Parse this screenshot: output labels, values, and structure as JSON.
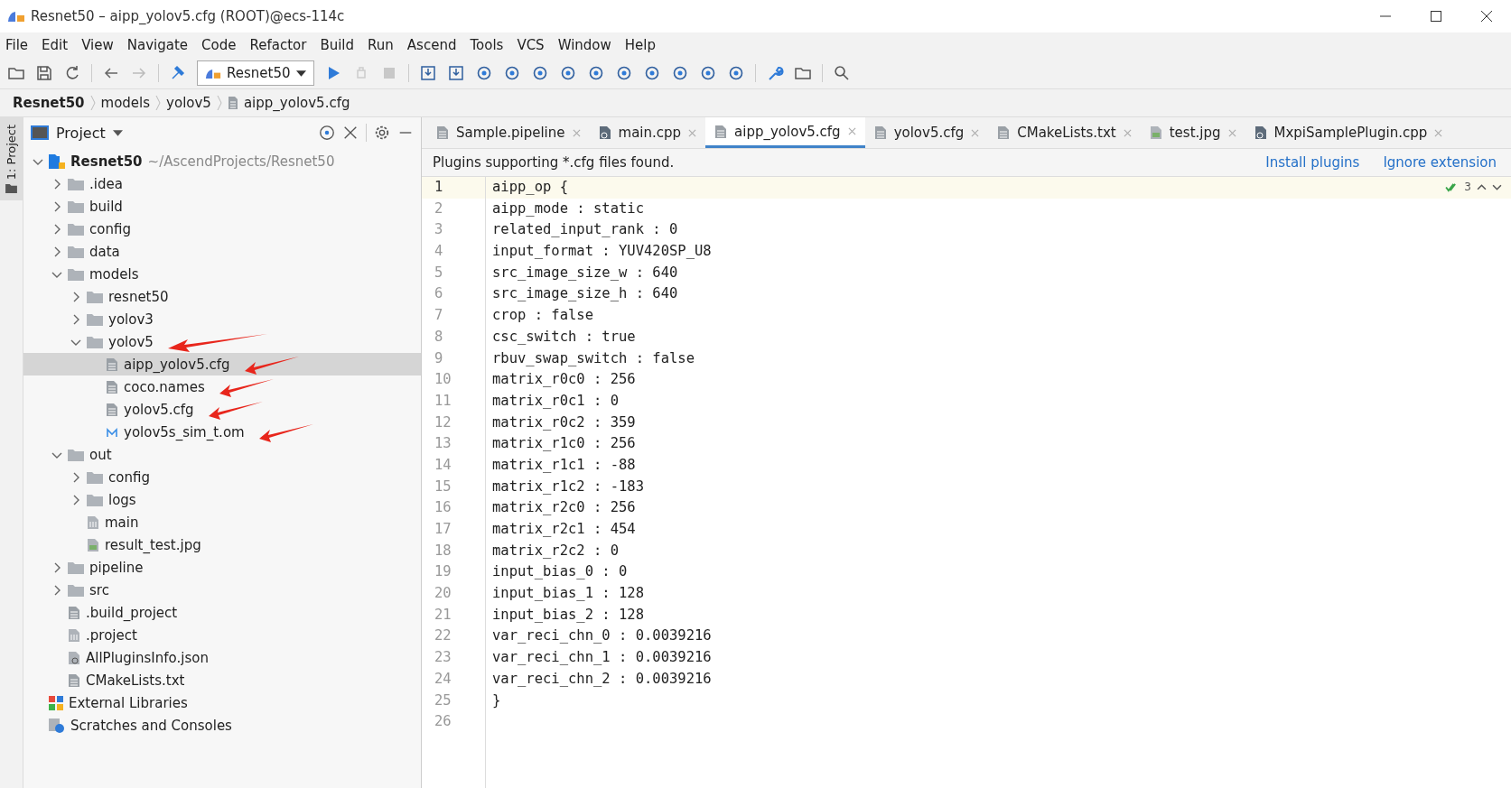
{
  "window": {
    "title": "Resnet50 – aipp_yolov5.cfg (ROOT)@ecs-114c"
  },
  "menu": [
    "File",
    "Edit",
    "View",
    "Navigate",
    "Code",
    "Refactor",
    "Build",
    "Run",
    "Ascend",
    "Tools",
    "VCS",
    "Window",
    "Help"
  ],
  "toolbar": {
    "run_config": "Resnet50"
  },
  "breadcrumb": [
    "Resnet50",
    "models",
    "yolov5",
    "aipp_yolov5.cfg"
  ],
  "side_strip": {
    "label": "1: Project"
  },
  "project": {
    "title": "Project",
    "tree": [
      {
        "name": "Resnet50",
        "path": "~/AscendProjects/Resnet50",
        "kind": "project",
        "expanded": true,
        "selected": false,
        "arrow": false,
        "children": [
          {
            "name": ".idea",
            "kind": "folder",
            "expanded": false,
            "selected": false,
            "arrow": false
          },
          {
            "name": "build",
            "kind": "folder",
            "expanded": false,
            "selected": false,
            "arrow": false
          },
          {
            "name": "config",
            "kind": "folder",
            "expanded": false,
            "selected": false,
            "arrow": false
          },
          {
            "name": "data",
            "kind": "folder",
            "expanded": false,
            "selected": false,
            "arrow": false
          },
          {
            "name": "models",
            "kind": "folder",
            "expanded": true,
            "selected": false,
            "arrow": false,
            "children": [
              {
                "name": "resnet50",
                "kind": "folder",
                "expanded": false,
                "selected": false,
                "arrow": false
              },
              {
                "name": "yolov3",
                "kind": "folder",
                "expanded": false,
                "selected": false,
                "arrow": false
              },
              {
                "name": "yolov5",
                "kind": "folder",
                "expanded": true,
                "selected": false,
                "arrow": true,
                "children": [
                  {
                    "name": "aipp_yolov5.cfg",
                    "kind": "file",
                    "selected": true,
                    "arrow": true
                  },
                  {
                    "name": "coco.names",
                    "kind": "file",
                    "selected": false,
                    "arrow": true
                  },
                  {
                    "name": "yolov5.cfg",
                    "kind": "file",
                    "selected": false,
                    "arrow": true
                  },
                  {
                    "name": "yolov5s_sim_t.om",
                    "kind": "model",
                    "selected": false,
                    "arrow": true
                  }
                ]
              }
            ]
          },
          {
            "name": "out",
            "kind": "folder",
            "expanded": true,
            "selected": false,
            "arrow": false,
            "children": [
              {
                "name": "config",
                "kind": "folder",
                "expanded": false,
                "selected": false,
                "arrow": false
              },
              {
                "name": "logs",
                "kind": "folder",
                "expanded": false,
                "selected": false,
                "arrow": false
              },
              {
                "name": "main",
                "kind": "binary",
                "selected": false,
                "arrow": false
              },
              {
                "name": "result_test.jpg",
                "kind": "image",
                "selected": false,
                "arrow": false
              }
            ]
          },
          {
            "name": "pipeline",
            "kind": "folder",
            "expanded": false,
            "selected": false,
            "arrow": false
          },
          {
            "name": "src",
            "kind": "folder",
            "expanded": false,
            "selected": false,
            "arrow": false
          },
          {
            "name": ".build_project",
            "kind": "file",
            "selected": false,
            "arrow": false
          },
          {
            "name": ".project",
            "kind": "binary",
            "selected": false,
            "arrow": false
          },
          {
            "name": "AllPluginsInfo.json",
            "kind": "json",
            "selected": false,
            "arrow": false
          },
          {
            "name": "CMakeLists.txt",
            "kind": "file",
            "selected": false,
            "arrow": false
          }
        ]
      },
      {
        "name": "External Libraries",
        "kind": "library",
        "selected": false,
        "arrow": false
      },
      {
        "name": "Scratches and Consoles",
        "kind": "scratch",
        "selected": false,
        "arrow": false
      }
    ]
  },
  "tabs": [
    {
      "label": "Sample.pipeline",
      "kind": "file",
      "selected": false
    },
    {
      "label": "main.cpp",
      "kind": "cpp",
      "selected": false
    },
    {
      "label": "aipp_yolov5.cfg",
      "kind": "file",
      "selected": true
    },
    {
      "label": "yolov5.cfg",
      "kind": "file",
      "selected": false
    },
    {
      "label": "CMakeLists.txt",
      "kind": "file",
      "selected": false
    },
    {
      "label": "test.jpg",
      "kind": "image",
      "selected": false
    },
    {
      "label": "MxpiSamplePlugin.cpp",
      "kind": "cpp",
      "selected": false
    }
  ],
  "notice": {
    "text": "Plugins supporting *.cfg files found.",
    "links": [
      "Install plugins",
      "Ignore extension"
    ]
  },
  "inspection": {
    "count": "3"
  },
  "code": [
    {
      "n": "1",
      "text": "aipp_op {",
      "current": true
    },
    {
      "n": "2",
      "text": "aipp_mode : static",
      "current": false
    },
    {
      "n": "3",
      "text": "related_input_rank : 0",
      "current": false
    },
    {
      "n": "4",
      "text": "input_format : YUV420SP_U8",
      "current": false
    },
    {
      "n": "5",
      "text": "src_image_size_w : 640",
      "current": false
    },
    {
      "n": "6",
      "text": "src_image_size_h : 640",
      "current": false
    },
    {
      "n": "7",
      "text": "crop : false",
      "current": false
    },
    {
      "n": "8",
      "text": "csc_switch : true",
      "current": false
    },
    {
      "n": "9",
      "text": "rbuv_swap_switch : false",
      "current": false
    },
    {
      "n": "10",
      "text": "matrix_r0c0 : 256",
      "current": false
    },
    {
      "n": "11",
      "text": "matrix_r0c1 : 0",
      "current": false
    },
    {
      "n": "12",
      "text": "matrix_r0c2 : 359",
      "current": false
    },
    {
      "n": "13",
      "text": "matrix_r1c0 : 256",
      "current": false
    },
    {
      "n": "14",
      "text": "matrix_r1c1 : -88",
      "current": false
    },
    {
      "n": "15",
      "text": "matrix_r1c2 : -183",
      "current": false
    },
    {
      "n": "16",
      "text": "matrix_r2c0 : 256",
      "current": false
    },
    {
      "n": "17",
      "text": "matrix_r2c1 : 454",
      "current": false
    },
    {
      "n": "18",
      "text": "matrix_r2c2 : 0",
      "current": false
    },
    {
      "n": "19",
      "text": "input_bias_0 : 0",
      "current": false
    },
    {
      "n": "20",
      "text": "input_bias_1 : 128",
      "current": false
    },
    {
      "n": "21",
      "text": "input_bias_2 : 128",
      "current": false
    },
    {
      "n": "22",
      "text": "var_reci_chn_0 : 0.0039216",
      "current": false
    },
    {
      "n": "23",
      "text": "var_reci_chn_1 : 0.0039216",
      "current": false
    },
    {
      "n": "24",
      "text": "var_reci_chn_2 : 0.0039216",
      "current": false
    },
    {
      "n": "25",
      "text": "}",
      "current": false
    },
    {
      "n": "26",
      "current": false
    }
  ]
}
